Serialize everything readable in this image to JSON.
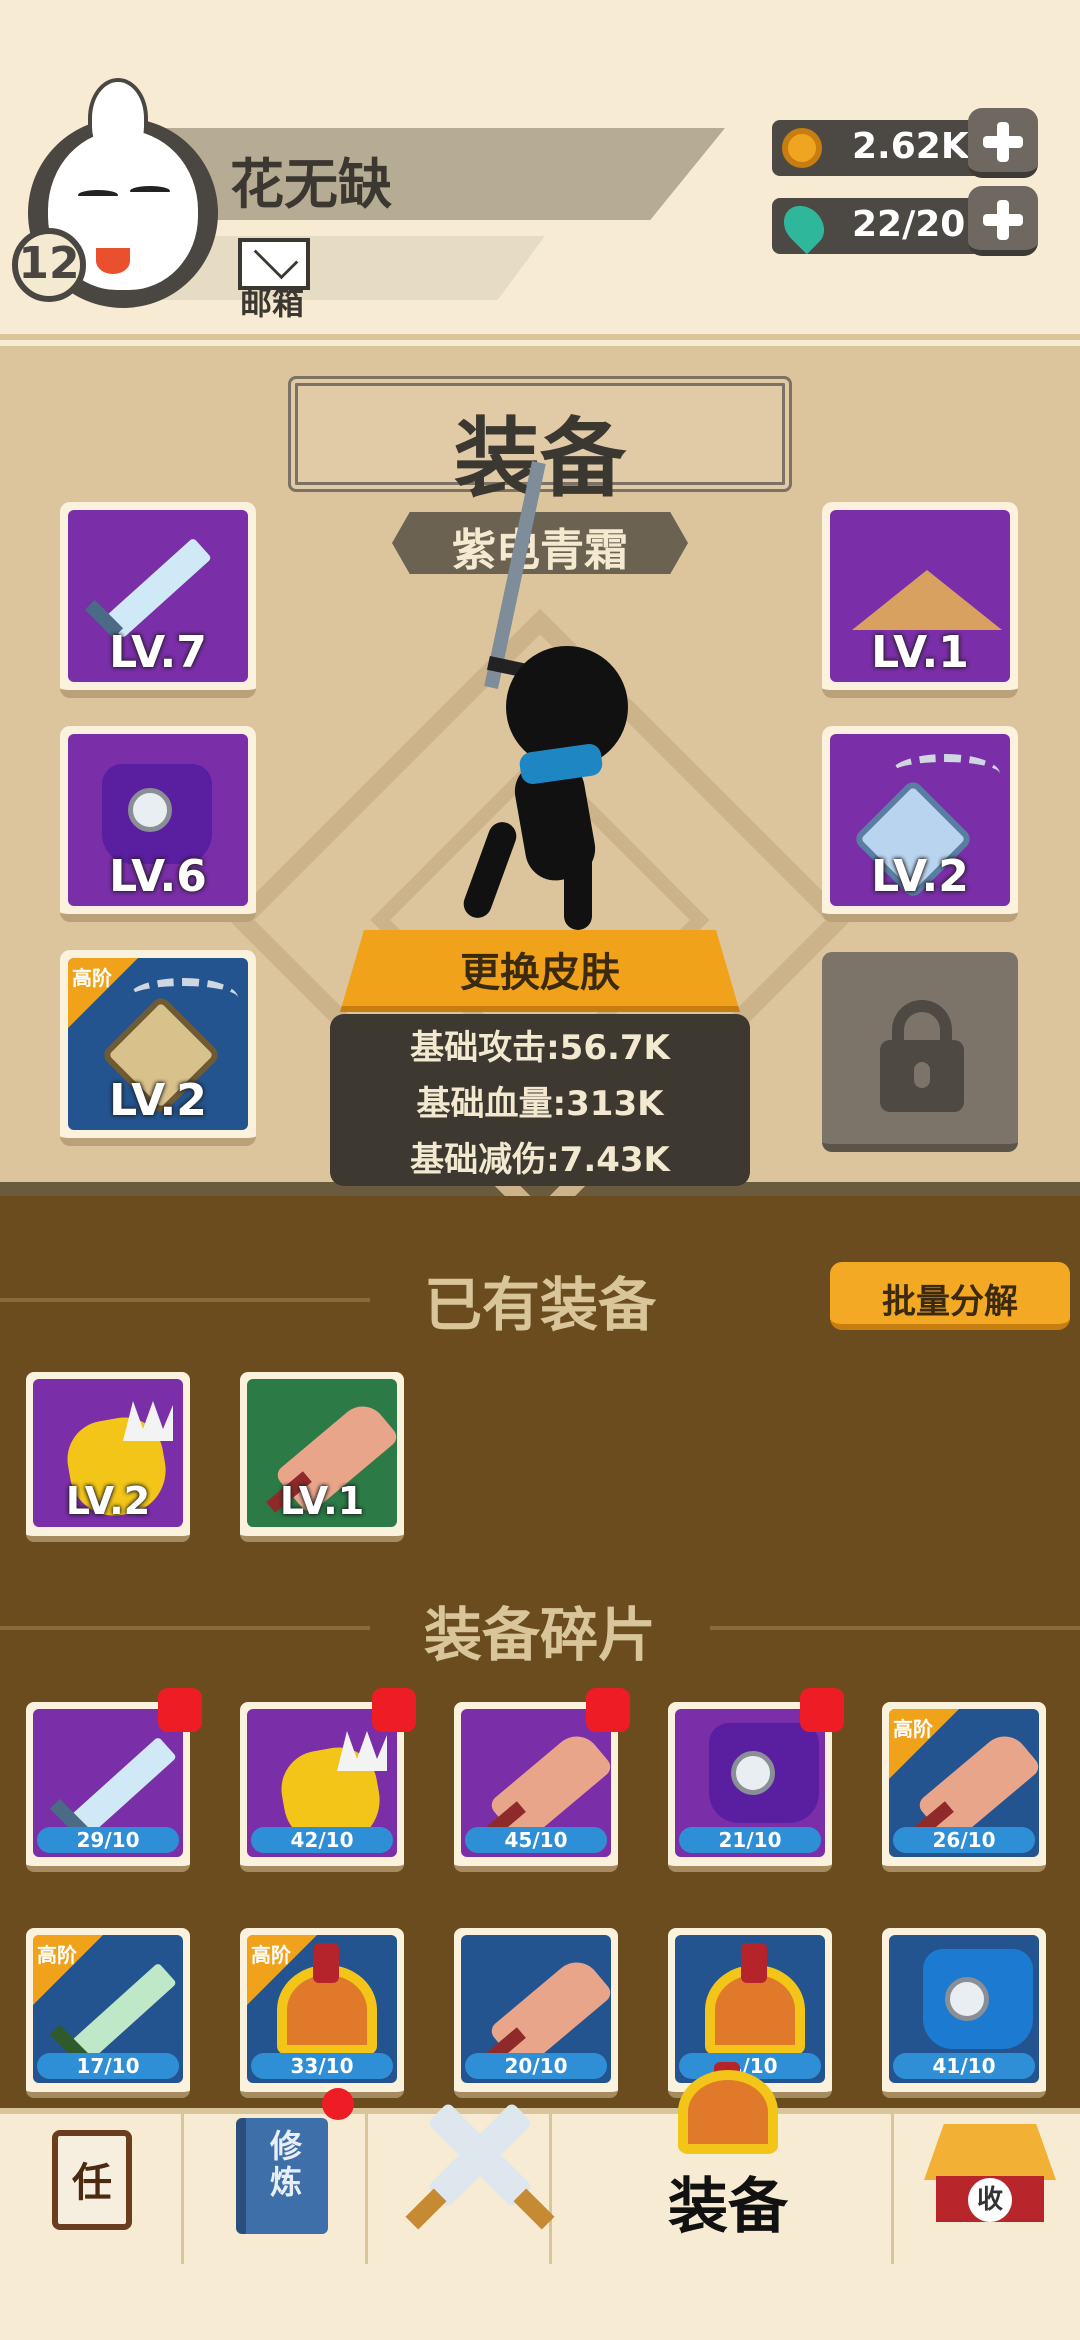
{
  "player": {
    "name": "花无缺",
    "level": "12",
    "mail_label": "邮箱"
  },
  "resources": {
    "gold": "2.62K",
    "energy": "22/20"
  },
  "equipment": {
    "title": "装备",
    "skin_name": "紫电青霜",
    "change_skin_label": "更换皮肤",
    "stats": [
      "基础攻击:56.7K",
      "基础血量:313K",
      "基础减伤:7.43K"
    ],
    "left_slots": [
      {
        "item": "sword",
        "level": "LV.7",
        "rarity": "purple"
      },
      {
        "item": "armor",
        "level": "LV.6",
        "rarity": "purple"
      },
      {
        "item": "amulet",
        "level": "LV.2",
        "rarity": "blue",
        "badge": "高阶"
      }
    ],
    "right_slots": [
      {
        "item": "hat",
        "level": "LV.1",
        "rarity": "purple"
      },
      {
        "item": "necklace",
        "level": "LV.2",
        "rarity": "purple"
      }
    ]
  },
  "owned": {
    "title": "已有装备",
    "decompose_label": "批量分解",
    "items": [
      {
        "item": "gauntlet",
        "level": "LV.2",
        "rarity": "purple"
      },
      {
        "item": "cleaver",
        "level": "LV.1",
        "rarity": "green"
      }
    ]
  },
  "fragments": {
    "title": "装备碎片",
    "row1": [
      {
        "item": "sword",
        "progress": "29/10",
        "rarity": "purple"
      },
      {
        "item": "gauntlet",
        "progress": "42/10",
        "rarity": "purple"
      },
      {
        "item": "cleaver",
        "progress": "45/10",
        "rarity": "purple"
      },
      {
        "item": "armor",
        "progress": "21/10",
        "rarity": "purple"
      },
      {
        "item": "cleaver",
        "progress": "26/10",
        "rarity": "blue",
        "badge": "高阶"
      }
    ],
    "row2": [
      {
        "item": "sword",
        "progress": "17/10",
        "rarity": "blue",
        "badge": "高阶"
      },
      {
        "item": "helmet",
        "progress": "33/10",
        "rarity": "blue",
        "badge": "高阶"
      },
      {
        "item": "cleaver",
        "progress": "20/10",
        "rarity": "blue"
      },
      {
        "item": "helmet",
        "progress": "…/10",
        "rarity": "blue"
      },
      {
        "item": "armor",
        "progress": "41/10",
        "rarity": "blue"
      }
    ]
  },
  "nav": {
    "task_char": "任",
    "cultivate_text": "修炼",
    "equip_label": "装备",
    "shop_char": "收"
  }
}
